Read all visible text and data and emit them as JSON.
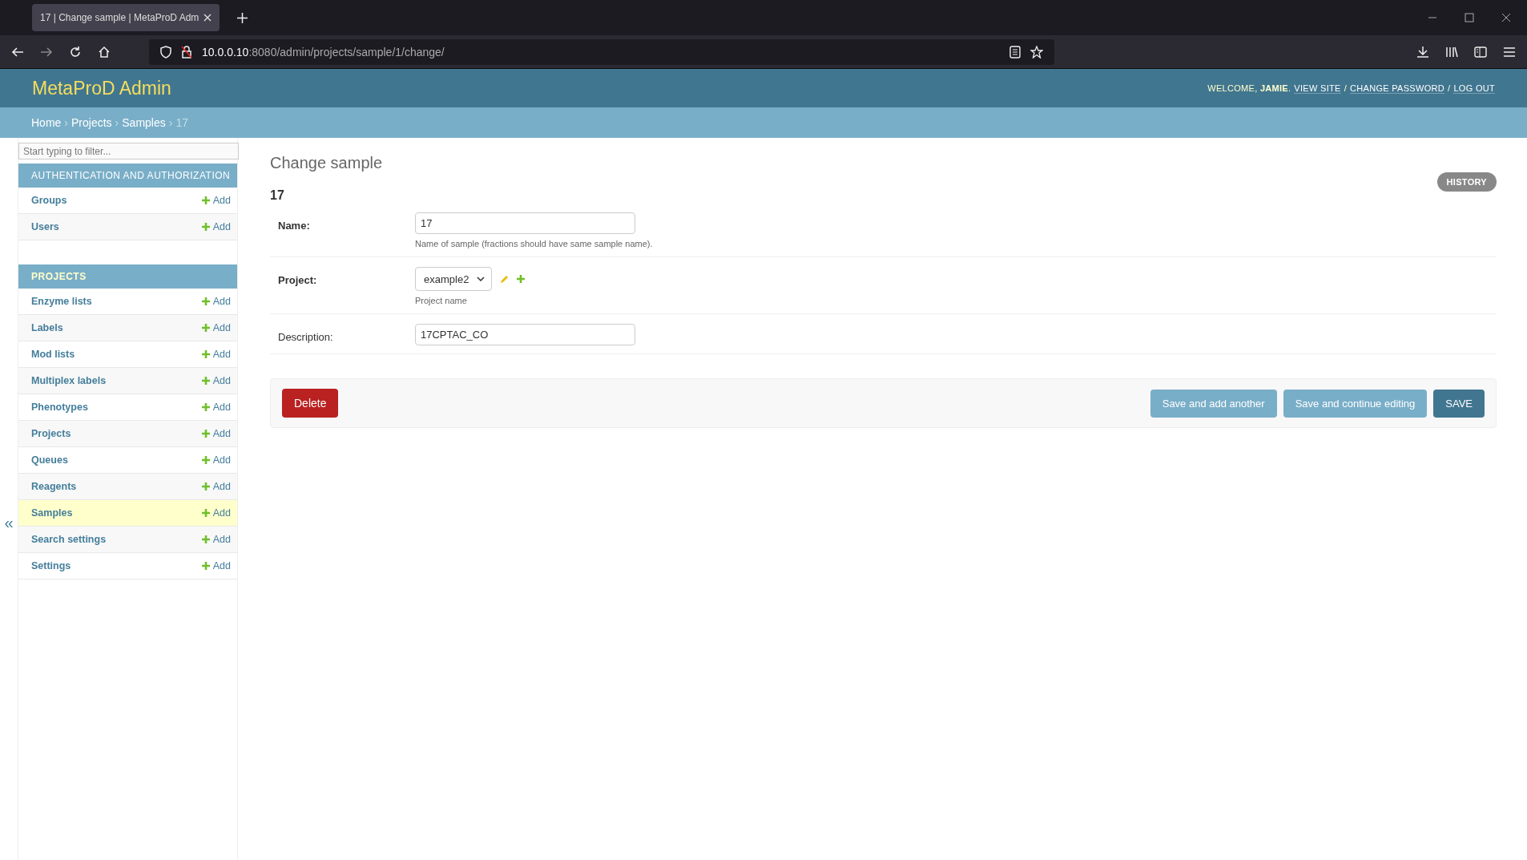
{
  "browser": {
    "tab_title": "17 | Change sample | MetaProD Adm",
    "url_host": "10.0.0.10",
    "url_rest": ":8080/admin/projects/sample/1/change/"
  },
  "header": {
    "brand": "MetaProD Admin",
    "welcome": "WELCOME, **JAMIE**.",
    "separator": "/",
    "links": [
      "VIEW SITE",
      "CHANGE PASSWORD",
      "LOG OUT"
    ]
  },
  "breadcrumbs": {
    "separator": "›",
    "items": [
      {
        "label": "Home",
        "kind": "link"
      },
      {
        "label": "Projects",
        "kind": "link"
      },
      {
        "label": "Samples",
        "kind": "link"
      },
      {
        "label": "17",
        "kind": "current"
      }
    ]
  },
  "sidebar": {
    "filter_placeholder": "Start typing to filter...",
    "collapse": "«",
    "sections": [
      {
        "title": "AUTHENTICATION AND AUTHORIZATION",
        "current": false,
        "models": [
          {
            "name": "Groups",
            "add": "Add",
            "selected": false
          },
          {
            "name": "Users",
            "add": "Add",
            "selected": false
          }
        ]
      },
      {
        "title": "PROJECTS",
        "current": true,
        "models": [
          {
            "name": "Enzyme lists",
            "add": "Add",
            "selected": false
          },
          {
            "name": "Labels",
            "add": "Add",
            "selected": false
          },
          {
            "name": "Mod lists",
            "add": "Add",
            "selected": false
          },
          {
            "name": "Multiplex labels",
            "add": "Add",
            "selected": false
          },
          {
            "name": "Phenotypes",
            "add": "Add",
            "selected": false
          },
          {
            "name": "Projects",
            "add": "Add",
            "selected": false
          },
          {
            "name": "Queues",
            "add": "Add",
            "selected": false
          },
          {
            "name": "Reagents",
            "add": "Add",
            "selected": false
          },
          {
            "name": "Samples",
            "add": "Add",
            "selected": true
          },
          {
            "name": "Search settings",
            "add": "Add",
            "selected": false
          },
          {
            "name": "Settings",
            "add": "Add",
            "selected": false
          }
        ]
      }
    ]
  },
  "form": {
    "title": "Change sample",
    "object_name": "17",
    "history": "HISTORY",
    "fields": [
      {
        "label": "Name:",
        "required": true,
        "kind": "text",
        "value": "17",
        "help": "Name of sample (fractions should have same sample name)."
      },
      {
        "label": "Project:",
        "required": true,
        "kind": "select",
        "value": "example2",
        "help": "Project name"
      },
      {
        "label": "Description:",
        "required": false,
        "kind": "text",
        "value": "17CPTAC_CO"
      }
    ],
    "buttons": [
      {
        "label": "Delete",
        "kind": "delete"
      },
      {
        "label": "Save and add another",
        "kind": "secondary"
      },
      {
        "label": "Save and continue editing",
        "kind": "secondary"
      },
      {
        "label": "SAVE",
        "kind": "default"
      }
    ]
  }
}
